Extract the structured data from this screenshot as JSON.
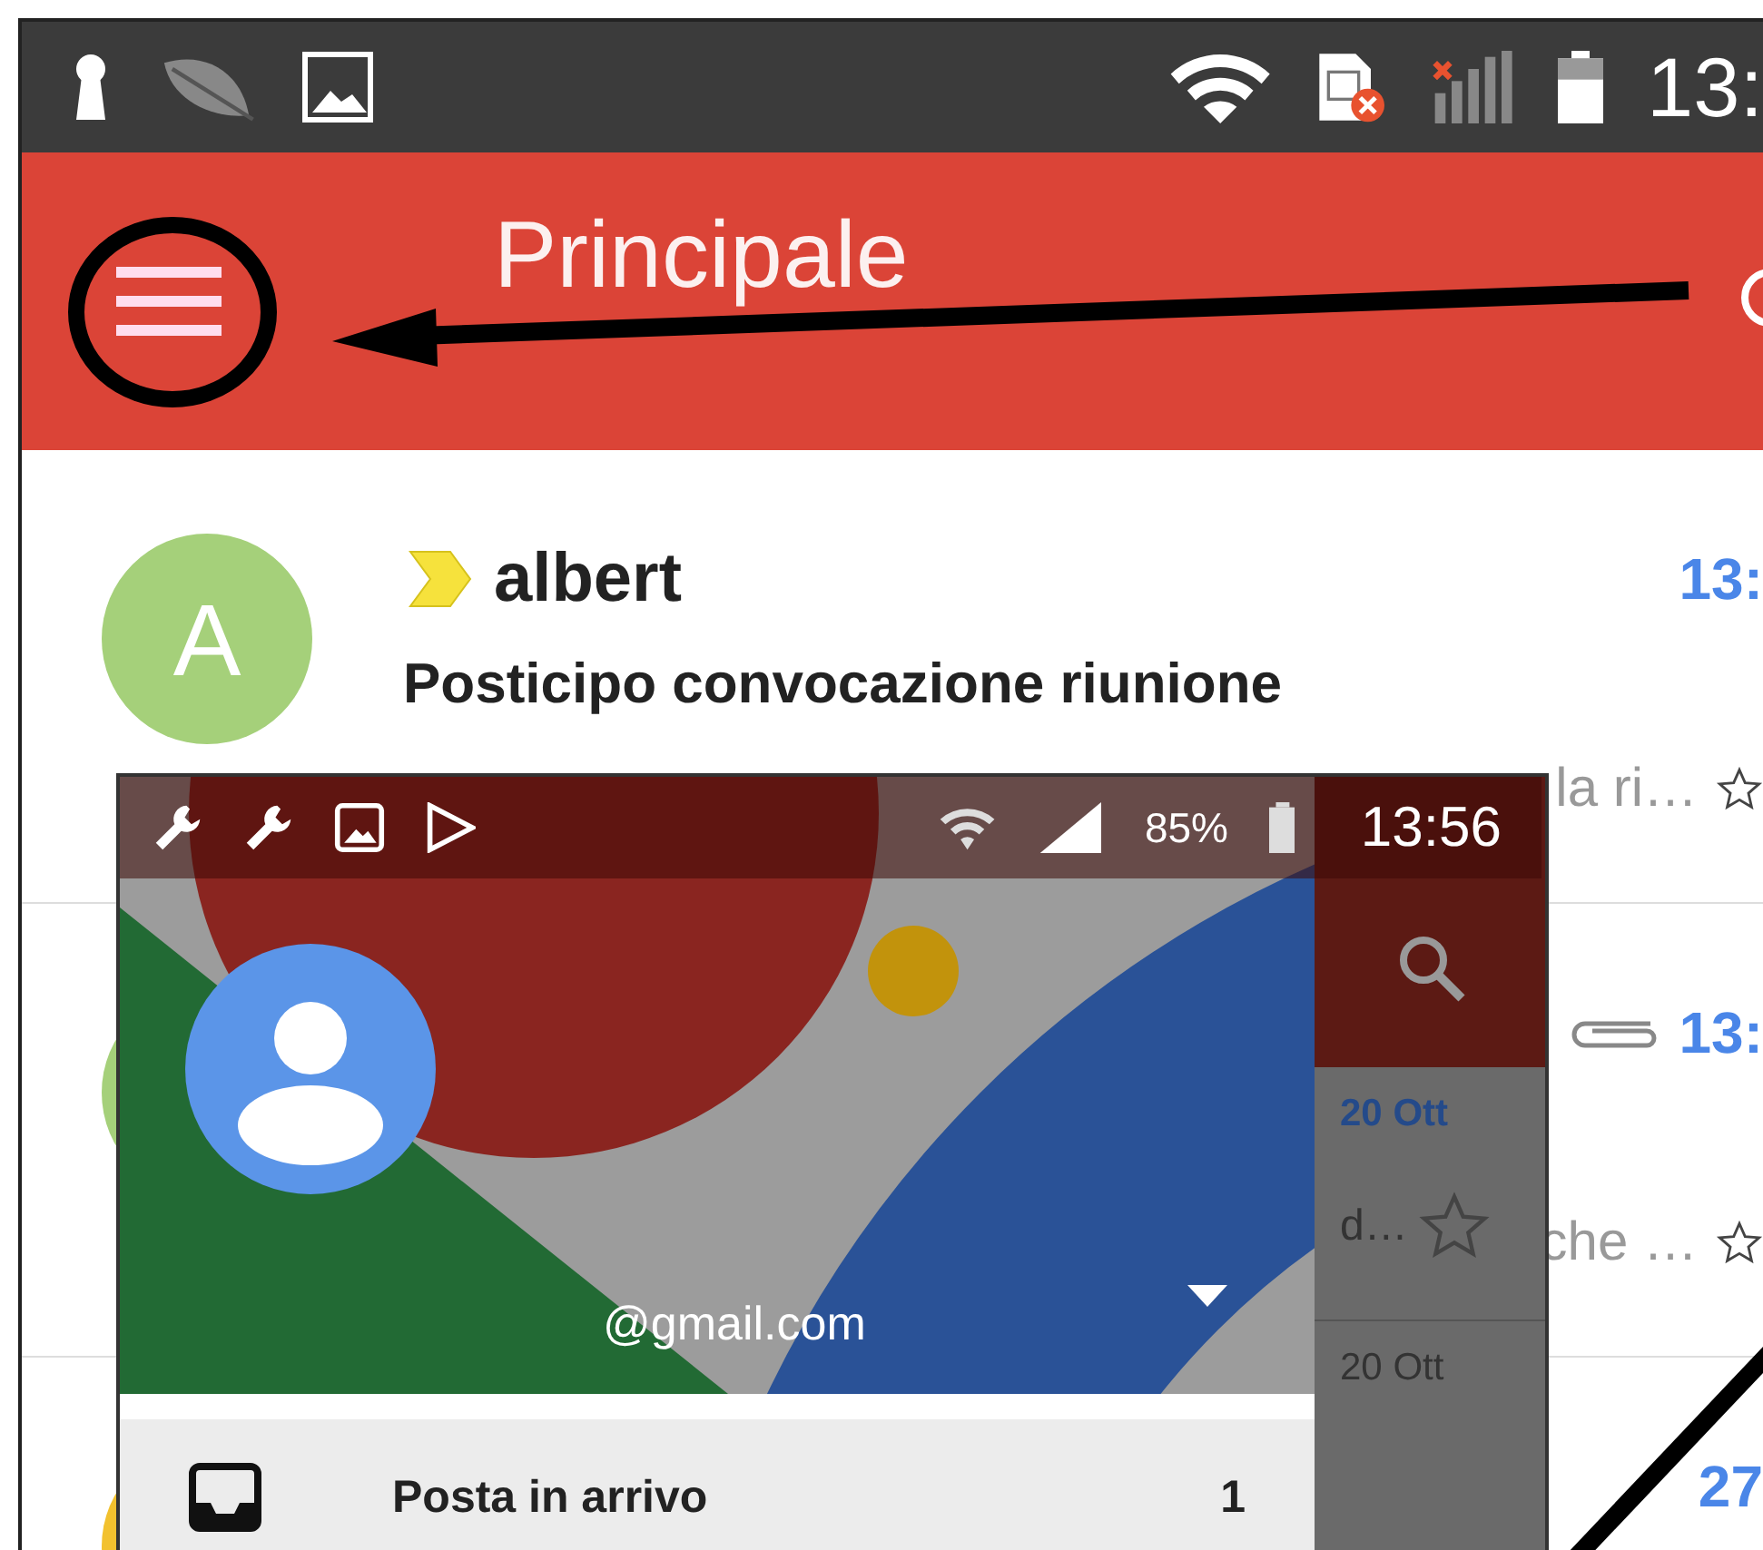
{
  "status_bar": {
    "time": "13:"
  },
  "header": {
    "title": "Principale"
  },
  "messages": [
    {
      "sender": "albert",
      "important": true,
      "avatar_letter": "A",
      "color": "#a5d07a",
      "time": "13:",
      "subject": "Posticipo convocazione riunione",
      "snippet": "la ri…",
      "starred": false
    },
    {
      "color": "#a5d07a",
      "time": "13:",
      "snippet": "che …",
      "attachment": true,
      "starred": false
    },
    {
      "color": "#f2c12e",
      "time": "27"
    }
  ],
  "drawer": {
    "status_bar": {
      "battery": "85%",
      "time": "13:56"
    },
    "account": {
      "email": "@gmail.com"
    },
    "folders": [
      {
        "label": "Posta in arrivo",
        "count": "1",
        "selected": true
      }
    ],
    "background_list": [
      {
        "date": "20 Ott",
        "unread": true,
        "snippet": "d…",
        "starred": false
      },
      {
        "date": "20 Ott",
        "unread": false
      }
    ]
  }
}
